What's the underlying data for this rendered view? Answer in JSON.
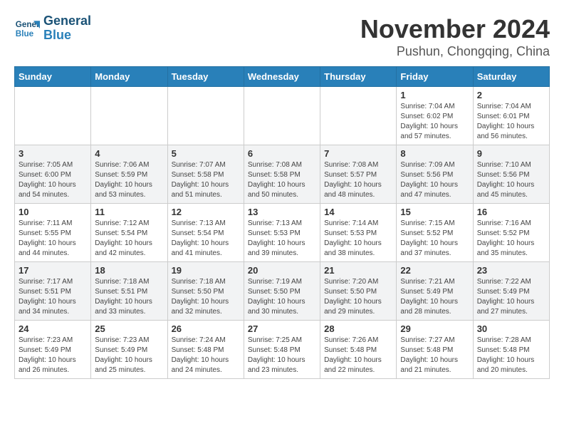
{
  "header": {
    "logo_line1": "General",
    "logo_line2": "Blue",
    "month": "November 2024",
    "location": "Pushun, Chongqing, China"
  },
  "days_of_week": [
    "Sunday",
    "Monday",
    "Tuesday",
    "Wednesday",
    "Thursday",
    "Friday",
    "Saturday"
  ],
  "weeks": [
    [
      {
        "day": "",
        "info": ""
      },
      {
        "day": "",
        "info": ""
      },
      {
        "day": "",
        "info": ""
      },
      {
        "day": "",
        "info": ""
      },
      {
        "day": "",
        "info": ""
      },
      {
        "day": "1",
        "info": "Sunrise: 7:04 AM\nSunset: 6:02 PM\nDaylight: 10 hours and 57 minutes."
      },
      {
        "day": "2",
        "info": "Sunrise: 7:04 AM\nSunset: 6:01 PM\nDaylight: 10 hours and 56 minutes."
      }
    ],
    [
      {
        "day": "3",
        "info": "Sunrise: 7:05 AM\nSunset: 6:00 PM\nDaylight: 10 hours and 54 minutes."
      },
      {
        "day": "4",
        "info": "Sunrise: 7:06 AM\nSunset: 5:59 PM\nDaylight: 10 hours and 53 minutes."
      },
      {
        "day": "5",
        "info": "Sunrise: 7:07 AM\nSunset: 5:58 PM\nDaylight: 10 hours and 51 minutes."
      },
      {
        "day": "6",
        "info": "Sunrise: 7:08 AM\nSunset: 5:58 PM\nDaylight: 10 hours and 50 minutes."
      },
      {
        "day": "7",
        "info": "Sunrise: 7:08 AM\nSunset: 5:57 PM\nDaylight: 10 hours and 48 minutes."
      },
      {
        "day": "8",
        "info": "Sunrise: 7:09 AM\nSunset: 5:56 PM\nDaylight: 10 hours and 47 minutes."
      },
      {
        "day": "9",
        "info": "Sunrise: 7:10 AM\nSunset: 5:56 PM\nDaylight: 10 hours and 45 minutes."
      }
    ],
    [
      {
        "day": "10",
        "info": "Sunrise: 7:11 AM\nSunset: 5:55 PM\nDaylight: 10 hours and 44 minutes."
      },
      {
        "day": "11",
        "info": "Sunrise: 7:12 AM\nSunset: 5:54 PM\nDaylight: 10 hours and 42 minutes."
      },
      {
        "day": "12",
        "info": "Sunrise: 7:13 AM\nSunset: 5:54 PM\nDaylight: 10 hours and 41 minutes."
      },
      {
        "day": "13",
        "info": "Sunrise: 7:13 AM\nSunset: 5:53 PM\nDaylight: 10 hours and 39 minutes."
      },
      {
        "day": "14",
        "info": "Sunrise: 7:14 AM\nSunset: 5:53 PM\nDaylight: 10 hours and 38 minutes."
      },
      {
        "day": "15",
        "info": "Sunrise: 7:15 AM\nSunset: 5:52 PM\nDaylight: 10 hours and 37 minutes."
      },
      {
        "day": "16",
        "info": "Sunrise: 7:16 AM\nSunset: 5:52 PM\nDaylight: 10 hours and 35 minutes."
      }
    ],
    [
      {
        "day": "17",
        "info": "Sunrise: 7:17 AM\nSunset: 5:51 PM\nDaylight: 10 hours and 34 minutes."
      },
      {
        "day": "18",
        "info": "Sunrise: 7:18 AM\nSunset: 5:51 PM\nDaylight: 10 hours and 33 minutes."
      },
      {
        "day": "19",
        "info": "Sunrise: 7:18 AM\nSunset: 5:50 PM\nDaylight: 10 hours and 32 minutes."
      },
      {
        "day": "20",
        "info": "Sunrise: 7:19 AM\nSunset: 5:50 PM\nDaylight: 10 hours and 30 minutes."
      },
      {
        "day": "21",
        "info": "Sunrise: 7:20 AM\nSunset: 5:50 PM\nDaylight: 10 hours and 29 minutes."
      },
      {
        "day": "22",
        "info": "Sunrise: 7:21 AM\nSunset: 5:49 PM\nDaylight: 10 hours and 28 minutes."
      },
      {
        "day": "23",
        "info": "Sunrise: 7:22 AM\nSunset: 5:49 PM\nDaylight: 10 hours and 27 minutes."
      }
    ],
    [
      {
        "day": "24",
        "info": "Sunrise: 7:23 AM\nSunset: 5:49 PM\nDaylight: 10 hours and 26 minutes."
      },
      {
        "day": "25",
        "info": "Sunrise: 7:23 AM\nSunset: 5:49 PM\nDaylight: 10 hours and 25 minutes."
      },
      {
        "day": "26",
        "info": "Sunrise: 7:24 AM\nSunset: 5:48 PM\nDaylight: 10 hours and 24 minutes."
      },
      {
        "day": "27",
        "info": "Sunrise: 7:25 AM\nSunset: 5:48 PM\nDaylight: 10 hours and 23 minutes."
      },
      {
        "day": "28",
        "info": "Sunrise: 7:26 AM\nSunset: 5:48 PM\nDaylight: 10 hours and 22 minutes."
      },
      {
        "day": "29",
        "info": "Sunrise: 7:27 AM\nSunset: 5:48 PM\nDaylight: 10 hours and 21 minutes."
      },
      {
        "day": "30",
        "info": "Sunrise: 7:28 AM\nSunset: 5:48 PM\nDaylight: 10 hours and 20 minutes."
      }
    ]
  ]
}
